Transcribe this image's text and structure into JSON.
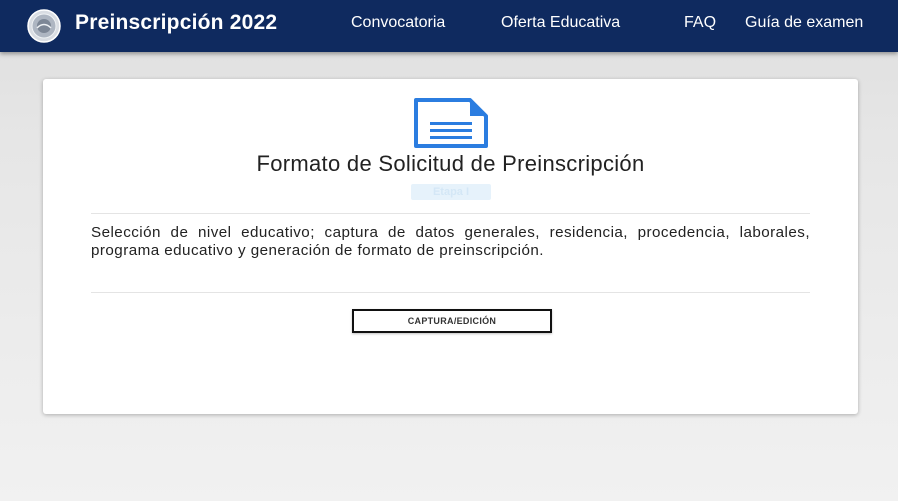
{
  "navbar": {
    "brand_title": "Preinscripción 2022",
    "logo_icon": "university-seal-icon",
    "links": [
      {
        "label": "Convocatoria"
      },
      {
        "label": "Oferta Educativa"
      },
      {
        "label": "FAQ"
      },
      {
        "label": "Guía de examen"
      }
    ],
    "background_color": "#0f2a5f"
  },
  "card": {
    "icon": "document-icon",
    "icon_color": "#2b7de0",
    "title": "Formato de Solicitud de Preinscripción",
    "badge": "Etapa I",
    "description": "Selección de nivel educativo; captura de datos generales, residencia, procedencia, laborales, programa educativo y generación de formato de preinscripción.",
    "button_label": "CAPTURA/EDICIÓN"
  }
}
